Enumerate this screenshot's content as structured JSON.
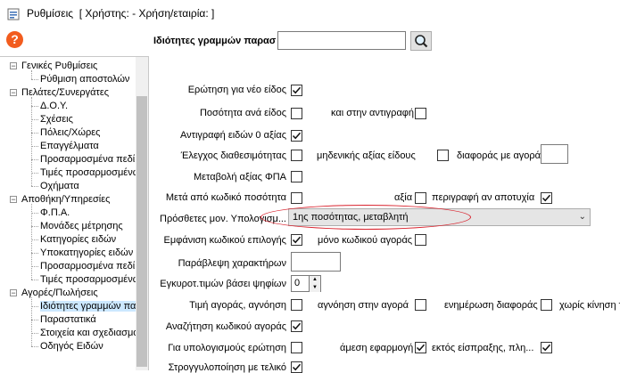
{
  "window": {
    "title": "Ρυθμίσεις  [ Χρήστης: - Χρήση/εταιρία: ]"
  },
  "help": {
    "glyph": "?"
  },
  "search": {
    "label": "Ιδιότητες γραμμών παρασ",
    "value": ""
  },
  "tree": [
    {
      "label": "Γενικές Ρυθμίσεις",
      "level": 0,
      "expander": "−"
    },
    {
      "label": "Ρύθμιση αποστολών",
      "level": 1
    },
    {
      "label": "Πελάτες/Συνεργάτες",
      "level": 0,
      "expander": "−"
    },
    {
      "label": "Δ.Ο.Υ.",
      "level": 1
    },
    {
      "label": "Σχέσεις",
      "level": 1
    },
    {
      "label": "Πόλεις/Χώρες",
      "level": 1
    },
    {
      "label": "Επαγγέλματα",
      "level": 1
    },
    {
      "label": "Προσαρμοσμένα πεδί",
      "level": 1
    },
    {
      "label": "Τιμές προσαρμοσμένω",
      "level": 1
    },
    {
      "label": "Οχήματα",
      "level": 1
    },
    {
      "label": "Αποθήκη/Υπηρεσίες",
      "level": 0,
      "expander": "−"
    },
    {
      "label": "Φ.Π.Α.",
      "level": 1
    },
    {
      "label": "Μονάδες μέτρησης",
      "level": 1
    },
    {
      "label": "Κατηγορίες ειδών",
      "level": 1
    },
    {
      "label": "Υποκατηγορίες ειδών",
      "level": 1
    },
    {
      "label": "Προσαρμοσμένα πεδί",
      "level": 1
    },
    {
      "label": "Τιμές προσαρμοσμένω",
      "level": 1
    },
    {
      "label": "Αγορές/Πωλήσεις",
      "level": 0,
      "expander": "−"
    },
    {
      "label": "Ιδιότητες γραμμών πα",
      "level": 1,
      "selected": true
    },
    {
      "label": "Παραστατικά",
      "level": 1
    },
    {
      "label": "Στοιχεία και σχεδιασμό",
      "level": 1
    },
    {
      "label": "Οδηγός Ειδών",
      "level": 1
    }
  ],
  "settings": {
    "erotisi_neo_eidos": {
      "label": "Ερώτηση για νέο είδος",
      "checked": true
    },
    "posotita_ana_eidos": {
      "label": "Ποσότητα ανά είδος",
      "checked": false
    },
    "kai_stin_antigrafi": {
      "label": "και στην αντιγραφή",
      "checked": false
    },
    "antigrafi_0_aksias": {
      "label": "Αντιγραφή ειδών 0 αξίας",
      "checked": true
    },
    "elegxos_diathesimotitas": {
      "label": "Έλεγχος διαθεσιμότητας",
      "checked": false
    },
    "mideniki_aksia": {
      "label": "μηδενικής αξίας είδους",
      "checked": false
    },
    "diaforas_me_agora": {
      "label": "διαφοράς με αγορά",
      "value": ""
    },
    "metavoli_fpa": {
      "label": "Μεταβολή αξίας ΦΠΑ",
      "checked": false
    },
    "meta_apo_kodiko": {
      "label": "Μετά από κωδικό ποσότητα",
      "checked": false
    },
    "aksia": {
      "label": "αξία",
      "checked": false
    },
    "perigrafi_apotyxia": {
      "label": "περιγραφή αν αποτυχία",
      "checked": true
    },
    "prosthetes_monades": {
      "label": "Πρόσθετες μον. Υπολογισμ...",
      "value": "1ης ποσότητας, μεταβλητή"
    },
    "emfanisi_kodikou": {
      "label": "Εμφάνιση κωδικού επιλογής",
      "checked": true
    },
    "mono_kodikos_agoras": {
      "label": "μόνο κωδικού αγοράς",
      "checked": false
    },
    "parablepsi_xaraktiron": {
      "label": "Παράβλεψη χαρακτήρων",
      "value": ""
    },
    "egkyrot_timon": {
      "label": "Εγκυροτ.τιμών βάσει ψηφίων",
      "value": "0"
    },
    "timi_agoras_agnoisi": {
      "label": "Τιμή αγοράς, αγνόηση",
      "checked": false
    },
    "agnoisi_stin_agora": {
      "label": "αγνόηση στην αγορά",
      "checked": false
    },
    "enimerosi_diaforas": {
      "label": "ενημέρωση διαφοράς",
      "checked": false
    },
    "xoris_kinisi": {
      "label": "χωρίς κίνηση τ",
      "checked": false
    },
    "anazitisi_kodikou_agoras": {
      "label": "Αναζήτηση κωδικού αγοράς",
      "checked": true
    },
    "gia_ypologismous": {
      "label": "Για υπολογισμούς ερώτηση",
      "checked": false
    },
    "amesi_efarmogi": {
      "label": "άμεση εφαρμογή",
      "checked": true
    },
    "ektos_eispraksis": {
      "label": "εκτός είσπραξης, πλη...",
      "checked": true
    },
    "strogylopoiisi": {
      "label": "Στρογγυλοποίηση με τελικό",
      "checked": true
    }
  }
}
